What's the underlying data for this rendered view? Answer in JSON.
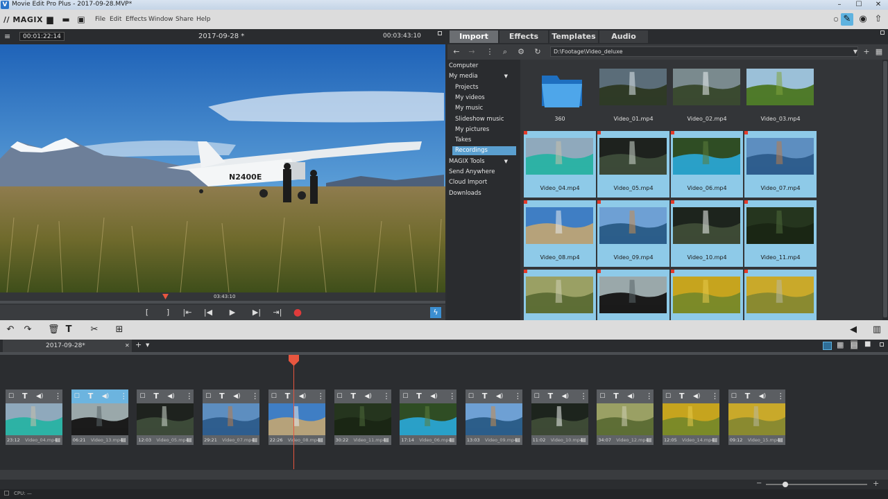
{
  "window": {
    "title": "Movie Edit Pro Plus - 2017-09-28.MVP*",
    "app_icon": "V",
    "minimize": "–",
    "maximize": "☐",
    "close": "✕"
  },
  "menubar": {
    "logo": "// MAGIX",
    "items": [
      "File",
      "Edit",
      "Effects",
      "Window",
      "Share",
      "Help"
    ]
  },
  "preview": {
    "position": "00:01:22:14",
    "project": "2017-09-28 *",
    "duration": "00:03:43:10",
    "scrub_time": "03:43:10",
    "plane_tail": "N2400E"
  },
  "tabs": [
    "Import",
    "Effects",
    "Templates",
    "Audio"
  ],
  "importer": {
    "path": "D:\\Footage\\Video_deluxe",
    "tree": [
      {
        "label": "Computer",
        "level": 0
      },
      {
        "label": "My media",
        "level": 0,
        "arrow": "▼"
      },
      {
        "label": "Projects",
        "level": 1
      },
      {
        "label": "My videos",
        "level": 1
      },
      {
        "label": "My music",
        "level": 1
      },
      {
        "label": "Slideshow music",
        "level": 1
      },
      {
        "label": "My pictures",
        "level": 1
      },
      {
        "label": "Takes",
        "level": 1
      },
      {
        "label": "Recordings",
        "level": 1,
        "selected": true
      },
      {
        "label": "MAGIX Tools",
        "level": 0,
        "arrow": "▼"
      },
      {
        "label": "Send Anywhere",
        "level": 0
      },
      {
        "label": "Cloud Import",
        "level": 0
      },
      {
        "label": "Downloads",
        "level": 0
      }
    ],
    "files": [
      {
        "label": "360",
        "kind": "folder",
        "selected": false
      },
      {
        "label": "Video_01.mp4",
        "scene": "waterfall-cliff",
        "selected": false
      },
      {
        "label": "Video_02.mp4",
        "scene": "waterfall-mist",
        "selected": false
      },
      {
        "label": "Video_03.mp4",
        "scene": "green-ridge",
        "selected": false
      },
      {
        "label": "Video_04.mp4",
        "scene": "crater-lake",
        "selected": true
      },
      {
        "label": "Video_05.mp4",
        "scene": "dark-falls",
        "selected": true
      },
      {
        "label": "Video_06.mp4",
        "scene": "blue-pool",
        "selected": true
      },
      {
        "label": "Video_07.mp4",
        "scene": "lake-shore",
        "selected": true
      },
      {
        "label": "Video_08.mp4",
        "scene": "plane-field",
        "selected": true
      },
      {
        "label": "Video_09.mp4",
        "scene": "mountain-lake",
        "selected": true
      },
      {
        "label": "Video_10.mp4",
        "scene": "forest-sun",
        "selected": true
      },
      {
        "label": "Video_11.mp4",
        "scene": "deep-forest",
        "selected": true
      },
      {
        "label": "",
        "scene": "creek-stream",
        "selected": true
      },
      {
        "label": "",
        "scene": "camera-operator",
        "selected": true
      },
      {
        "label": "",
        "scene": "yellow-canopy",
        "selected": true
      },
      {
        "label": "",
        "scene": "yellow-path",
        "selected": true
      }
    ]
  },
  "timeline": {
    "tab": "2017-09-28*",
    "clips": [
      {
        "dur": "23:12",
        "name": "Video_04.mp4",
        "scene": "crater-lake",
        "selected": false
      },
      {
        "dur": "06:21",
        "name": "Video_13.mp4",
        "scene": "camera-operator",
        "selected": true
      },
      {
        "dur": "12:03",
        "name": "Video_05.mp4",
        "scene": "dark-falls",
        "selected": false
      },
      {
        "dur": "29:21",
        "name": "Video_07.mp4",
        "scene": "lake-shore",
        "selected": false
      },
      {
        "dur": "22:26",
        "name": "Video_08.mp4",
        "scene": "plane-field",
        "selected": false
      },
      {
        "dur": "30:22",
        "name": "Video_11.mp4",
        "scene": "deep-forest",
        "selected": false
      },
      {
        "dur": "17:14",
        "name": "Video_06.mp4",
        "scene": "blue-pool",
        "selected": false
      },
      {
        "dur": "13:03",
        "name": "Video_09.mp4",
        "scene": "mountain-lake",
        "selected": false
      },
      {
        "dur": "11:02",
        "name": "Video_10.mp4",
        "scene": "forest-sun",
        "selected": false
      },
      {
        "dur": "34:07",
        "name": "Video_12.mp4",
        "scene": "creek-stream",
        "selected": false
      },
      {
        "dur": "12:05",
        "name": "Video_14.mp4",
        "scene": "yellow-canopy",
        "selected": false
      },
      {
        "dur": "09:12",
        "name": "Video_15.mp4",
        "scene": "yellow-path",
        "selected": false
      }
    ]
  },
  "status": {
    "cpu": "CPU: —"
  },
  "colors": {
    "accent": "#5fb3e0",
    "selection": "#8ecae8",
    "playhead": "#e8563f",
    "record": "#e03b3b"
  }
}
